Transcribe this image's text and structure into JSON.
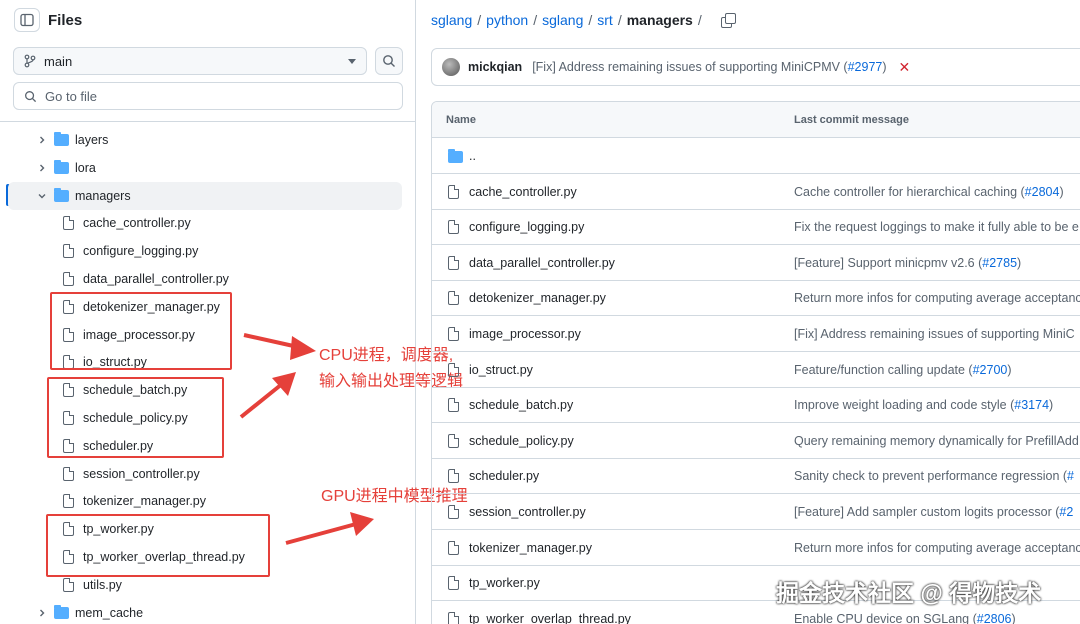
{
  "sidebar": {
    "title": "Files",
    "branch": "main",
    "goto_placeholder": "Go to file",
    "tree": [
      {
        "label": "layers",
        "kind": "folder",
        "level": 1,
        "expanded": false
      },
      {
        "label": "lora",
        "kind": "folder",
        "level": 1,
        "expanded": false
      },
      {
        "label": "managers",
        "kind": "folder",
        "level": 1,
        "expanded": true,
        "active": true
      },
      {
        "label": "cache_controller.py",
        "kind": "file",
        "level": 2
      },
      {
        "label": "configure_logging.py",
        "kind": "file",
        "level": 2
      },
      {
        "label": "data_parallel_controller.py",
        "kind": "file",
        "level": 2
      },
      {
        "label": "detokenizer_manager.py",
        "kind": "file",
        "level": 2
      },
      {
        "label": "image_processor.py",
        "kind": "file",
        "level": 2
      },
      {
        "label": "io_struct.py",
        "kind": "file",
        "level": 2
      },
      {
        "label": "schedule_batch.py",
        "kind": "file",
        "level": 2
      },
      {
        "label": "schedule_policy.py",
        "kind": "file",
        "level": 2
      },
      {
        "label": "scheduler.py",
        "kind": "file",
        "level": 2
      },
      {
        "label": "session_controller.py",
        "kind": "file",
        "level": 2
      },
      {
        "label": "tokenizer_manager.py",
        "kind": "file",
        "level": 2
      },
      {
        "label": "tp_worker.py",
        "kind": "file",
        "level": 2
      },
      {
        "label": "tp_worker_overlap_thread.py",
        "kind": "file",
        "level": 2
      },
      {
        "label": "utils.py",
        "kind": "file",
        "level": 2
      },
      {
        "label": "mem_cache",
        "kind": "folder",
        "level": 1,
        "expanded": false
      }
    ]
  },
  "annotations": {
    "cpu_line1": "CPU进程，调度器,",
    "cpu_line2": "输入输出处理等逻辑",
    "gpu": "GPU进程中模型推理",
    "color": "#e5403a"
  },
  "breadcrumb": {
    "parts": [
      "sglang",
      "python",
      "sglang",
      "srt"
    ],
    "current": "managers"
  },
  "latest_commit": {
    "author": "mickqian",
    "message": "[Fix] Address remaining issues of supporting MiniCPMV (",
    "pr": "#2977",
    "message_end": ")"
  },
  "file_table": {
    "col_name": "Name",
    "col_commit": "Last commit message",
    "rows": [
      {
        "name": "..",
        "kind": "folder",
        "msg": "",
        "pr": "",
        "end": ""
      },
      {
        "name": "cache_controller.py",
        "kind": "file",
        "msg": "Cache controller for hierarchical caching (",
        "pr": "#2804",
        "end": ")"
      },
      {
        "name": "configure_logging.py",
        "kind": "file",
        "msg": "Fix the request loggings to make it fully able to be e",
        "pr": "",
        "end": ""
      },
      {
        "name": "data_parallel_controller.py",
        "kind": "file",
        "msg": "[Feature] Support minicpmv v2.6 (",
        "pr": "#2785",
        "end": ")"
      },
      {
        "name": "detokenizer_manager.py",
        "kind": "file",
        "msg": "Return more infos for computing average acceptanc",
        "pr": "",
        "end": ""
      },
      {
        "name": "image_processor.py",
        "kind": "file",
        "msg": "[Fix] Address remaining issues of supporting MiniC",
        "pr": "",
        "end": ""
      },
      {
        "name": "io_struct.py",
        "kind": "file",
        "msg": "Feature/function calling update (",
        "pr": "#2700",
        "end": ")"
      },
      {
        "name": "schedule_batch.py",
        "kind": "file",
        "msg": "Improve weight loading and code style (",
        "pr": "#3174",
        "end": ")"
      },
      {
        "name": "schedule_policy.py",
        "kind": "file",
        "msg": "Query remaining memory dynamically for PrefillAdd",
        "pr": "",
        "end": ""
      },
      {
        "name": "scheduler.py",
        "kind": "file",
        "msg": "Sanity check to prevent performance regression (",
        "pr": "#",
        "end": ""
      },
      {
        "name": "session_controller.py",
        "kind": "file",
        "msg": "[Feature] Add sampler custom logits processor (",
        "pr": "#2",
        "end": ""
      },
      {
        "name": "tokenizer_manager.py",
        "kind": "file",
        "msg": "Return more infos for computing average acceptanc",
        "pr": "",
        "end": ""
      },
      {
        "name": "tp_worker.py",
        "kind": "file",
        "msg": "",
        "pr": "",
        "end": ""
      },
      {
        "name": "tp_worker_overlap_thread.py",
        "kind": "file",
        "msg": "Enable CPU device on SGLang (",
        "pr": "#2806",
        "end": ")"
      }
    ]
  },
  "watermark": "掘金技术社区 @ 得物技术"
}
